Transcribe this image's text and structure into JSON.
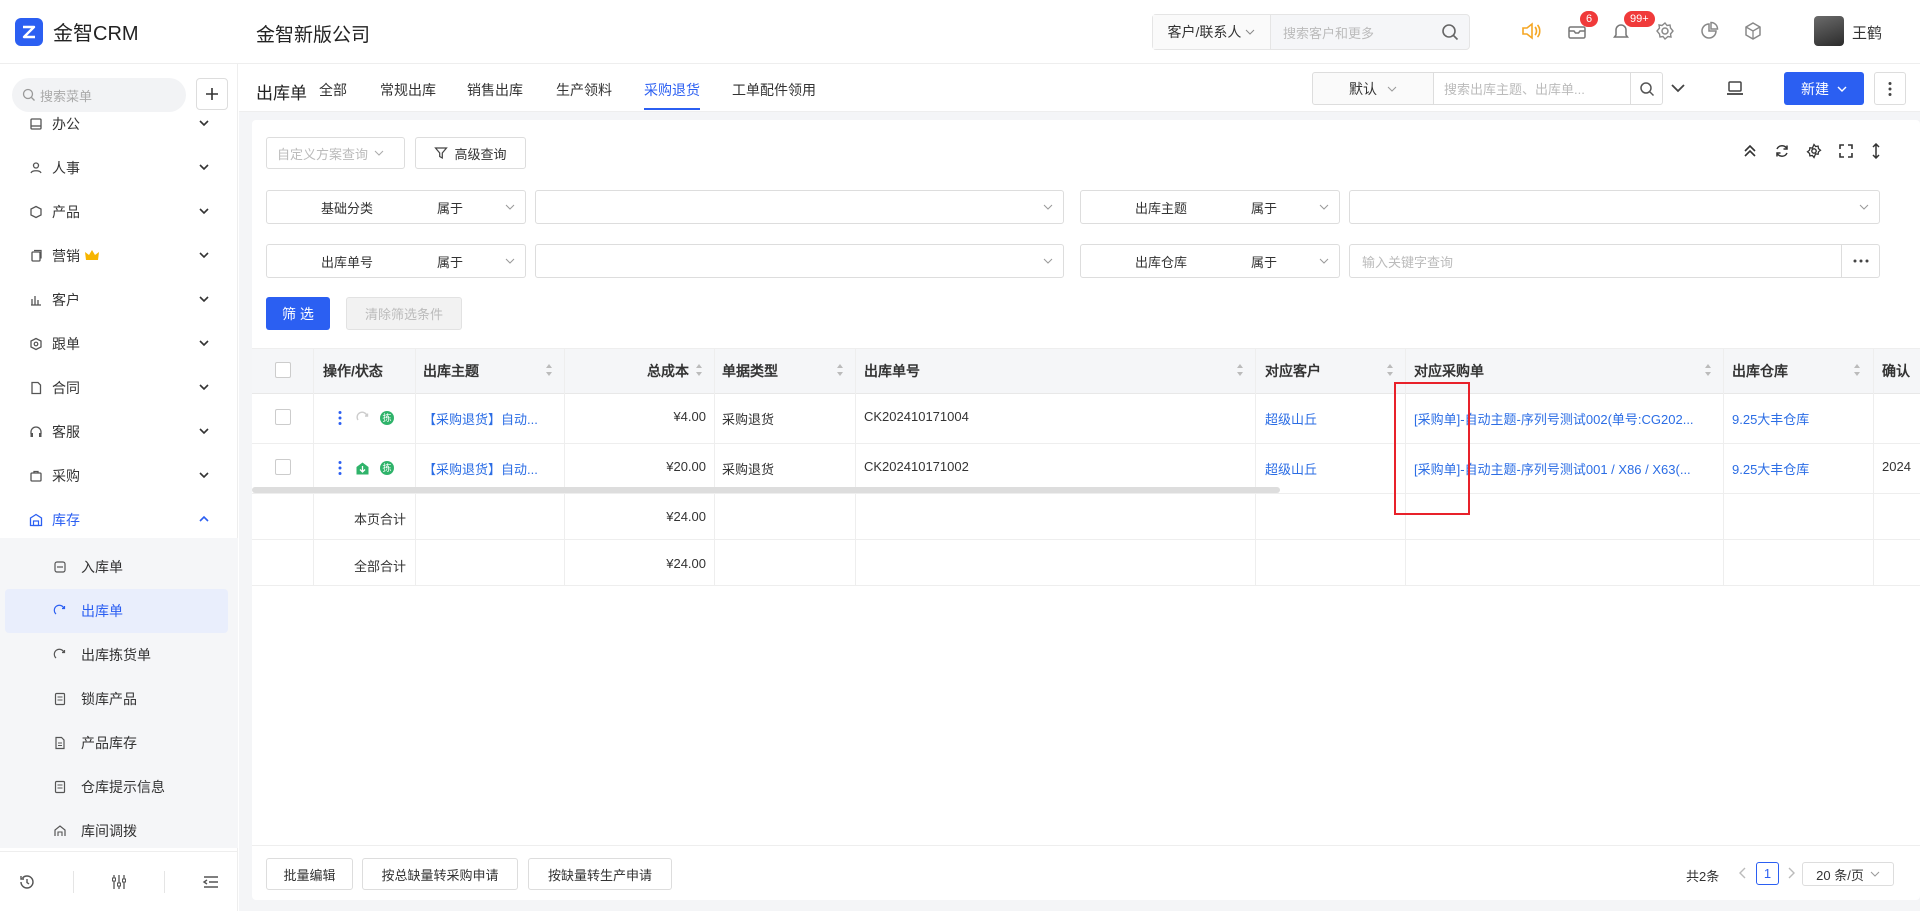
{
  "app": {
    "logo_text": "金智CRM",
    "company": "金智新版公司"
  },
  "topbar": {
    "search_type": "客户/联系人",
    "search_placeholder": "搜索客户和更多",
    "mail_badge": "6",
    "bell_badge": "99+",
    "username": "王鹤"
  },
  "sidebar": {
    "search_placeholder": "搜索菜单",
    "items": [
      {
        "label": "办公",
        "icon": "office-icon"
      },
      {
        "label": "人事",
        "icon": "hr-icon"
      },
      {
        "label": "产品",
        "icon": "product-icon"
      },
      {
        "label": "营销",
        "icon": "marketing-icon"
      },
      {
        "label": "客户",
        "icon": "customer-icon"
      },
      {
        "label": "跟单",
        "icon": "followup-icon"
      },
      {
        "label": "合同",
        "icon": "contract-icon"
      },
      {
        "label": "客服",
        "icon": "service-icon"
      },
      {
        "label": "采购",
        "icon": "purchase-icon"
      },
      {
        "label": "库存",
        "icon": "inventory-icon"
      }
    ],
    "sub_items": [
      {
        "label": "入库单"
      },
      {
        "label": "出库单"
      },
      {
        "label": "出库拣货单"
      },
      {
        "label": "锁库产品"
      },
      {
        "label": "产品库存"
      },
      {
        "label": "仓库提示信息"
      },
      {
        "label": "库间调拨"
      }
    ]
  },
  "header": {
    "title": "出库单",
    "tabs": [
      "全部",
      "常规出库",
      "销售出库",
      "生产领料",
      "采购退货",
      "工单配件领用"
    ],
    "active_tab": "采购退货",
    "view": "默认",
    "search_placeholder": "搜索出库主题、出库单...",
    "new_label": "新建"
  },
  "filters": {
    "scheme_placeholder": "自定义方案查询",
    "advanced_label": "高级查询",
    "rows": [
      {
        "label": "基础分类",
        "op": "属于",
        "value": ""
      },
      {
        "label": "出库主题",
        "op": "属于",
        "value": ""
      },
      {
        "label": "出库单号",
        "op": "属于",
        "value": ""
      },
      {
        "label": "出库仓库",
        "op": "属于",
        "value": "输入关键字查询"
      }
    ],
    "filter_label": "筛 选",
    "clear_label": "清除筛选条件"
  },
  "table": {
    "headers": [
      "操作/状态",
      "出库主题",
      "总成本",
      "单据类型",
      "出库单号",
      "对应客户",
      "对应采购单",
      "出库仓库",
      "确认"
    ],
    "rows": [
      {
        "subject": "【采购退货】自动...",
        "cost": "¥4.00",
        "type": "采购退货",
        "no": "CK202410171004",
        "customer": "超级山丘",
        "po": "[采购单]-自动主题-序列号测试002(单号:CG202...",
        "warehouse": "9.25大丰仓库",
        "confirm": ""
      },
      {
        "subject": "【采购退货】自动...",
        "cost": "¥20.00",
        "type": "采购退货",
        "no": "CK202410171002",
        "customer": "超级山丘",
        "po": "[采购单]-自动主题-序列号测试001 / X86 / X63(...",
        "warehouse": "9.25大丰仓库",
        "confirm": "2024"
      }
    ],
    "page_total_label": "本页合计",
    "page_total": "¥24.00",
    "all_total_label": "全部合计",
    "all_total": "¥24.00"
  },
  "footer": {
    "batch_edit": "批量编辑",
    "to_purchase": "按总缺量转采购申请",
    "to_production": "按缺量转生产申请",
    "total": "共2条",
    "page": "1",
    "page_size": "20 条/页"
  },
  "colors": {
    "accent": "#2b5ff2",
    "link": "#2b6de5",
    "highlight": "#e8212a",
    "status_green": "#2fb36a"
  }
}
